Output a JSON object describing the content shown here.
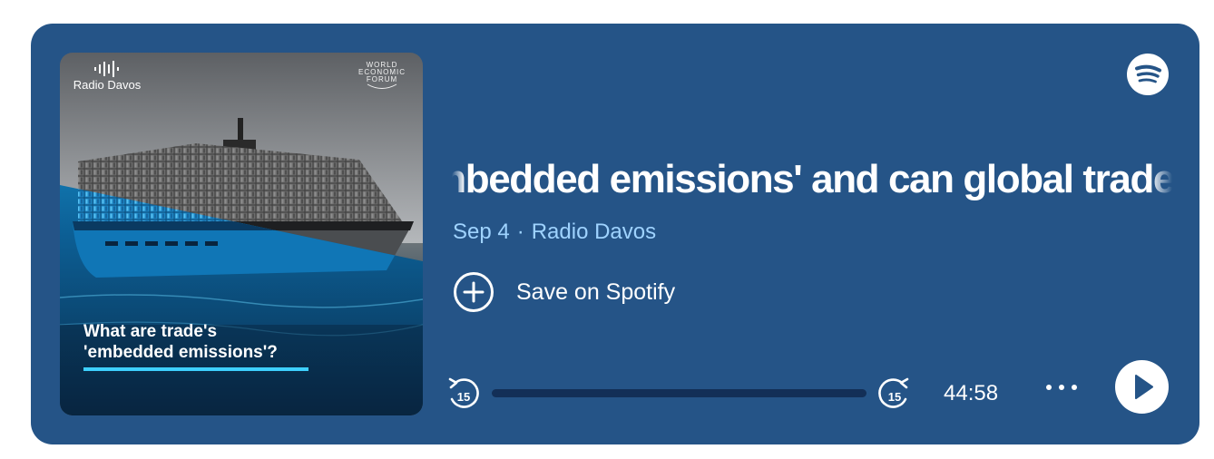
{
  "cover": {
    "brand_label": "Radio Davos",
    "partner_logo_lines": [
      "WORLD",
      "ECONOMIC",
      "FORUM"
    ],
    "caption_lines": [
      "What are trade's",
      "'embedded emissions'?"
    ]
  },
  "episode": {
    "title": "What are trade's 'embedded emissions' and can global trade",
    "date": "Sep 4",
    "separator": "·",
    "show": "Radio Davos"
  },
  "actions": {
    "save_label": "Save on Spotify"
  },
  "player": {
    "skip_back_seconds": "15",
    "skip_forward_seconds": "15",
    "duration": "44:58",
    "progress": 0
  },
  "icons": {
    "brand": "spotify-logo-icon",
    "save": "add-circle-icon",
    "back": "skip-back-15-icon",
    "forward": "skip-forward-15-icon",
    "more": "more-options-icon",
    "play": "play-icon"
  },
  "colors": {
    "card_background": "#255487",
    "meta_text": "#9fd3ff",
    "progress_track": "#132f57",
    "cover_accent": "#3ed0ff"
  }
}
